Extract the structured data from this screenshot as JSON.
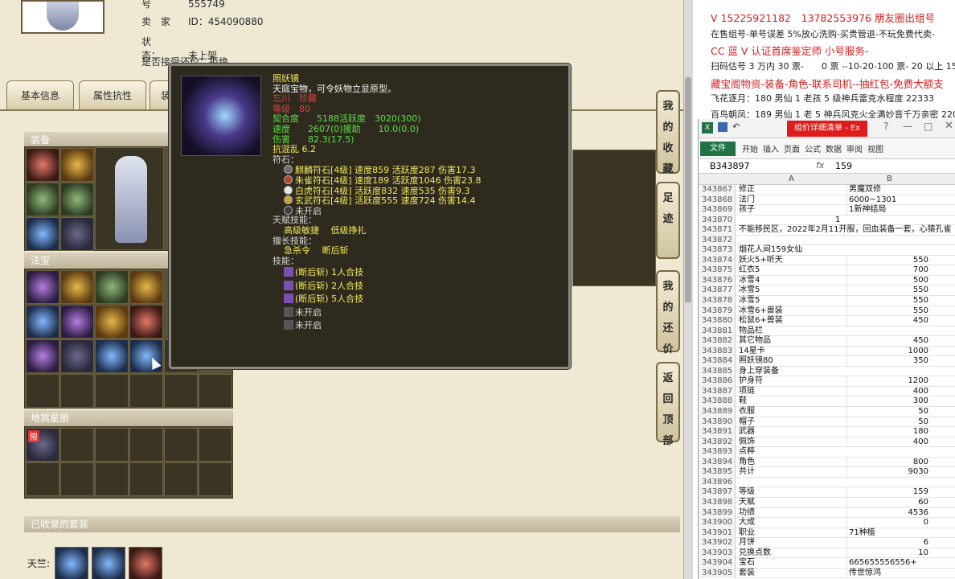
{
  "profile": {
    "number_label": "号",
    "number_value": "555749",
    "seller_label": "卖　家",
    "seller_value": "ID：454090880",
    "status_label": "状　　态：",
    "status_value": "未上架",
    "accept_label": "是否接受还价：",
    "accept_value": "拒绝"
  },
  "tabs": [
    "基本信息",
    "属性抗性",
    "装"
  ],
  "sections": {
    "equipment": "装备",
    "fabao": "法宝",
    "dishastars": "地煞星册",
    "suits": "已收录的套装",
    "tianzhu_label": "天竺:"
  },
  "badge_limited": "限",
  "side_buttons": [
    "我的收藏",
    "足迹",
    "我的还价",
    "返回顶部"
  ],
  "tooltip": {
    "name": "照妖镜",
    "desc": "天庭宝物，可令妖物立显原型。",
    "school": "忘川　珍藏",
    "level": "等级　80",
    "fit": "契合度　　5188活跃度　3020(300)",
    "speed": "速度　　2607(0)援助　　10.0(0.0)",
    "damage": "伤害　　82.3(17.5)",
    "resist": "抗混乱 6.2",
    "runes_label": "符石：",
    "runes": [
      "麒麟符石[4级] 速度859 活跃度287 伤害17.3",
      "朱雀符石[4级] 速度189 活跃度1046 伤害23.8",
      "白虎符石[4级] 活跃度832 速度535 伤害9.3",
      "玄武符石[4级] 活跃度555 速度724 伤害14.4",
      "未开启"
    ],
    "talent_label": "天赋技能：",
    "talent": "高级敏捷　 低级挣扎",
    "good_at_label": "擅长技能：",
    "good_at": "急杀令　 断后斩",
    "skills_label": "技能：",
    "skills": [
      "(断后斩) 1人合技",
      "(断后斩) 2人合技",
      "(断后斩) 5人合技",
      "未开启",
      "未开启"
    ]
  },
  "right_top": [
    "V 15225921182　13782553976 朋友圈出组号",
    "在售组号-单号误差 5%放心洗购-买贵管退-不玩免费代卖-",
    "CC 蓝 V 认证首席鉴定师 小号服务-",
    "扫码估号 3 万内 30 票-　　0 票 --10-20-100 票- 20 以上 150",
    "藏宝阁物资-装备-角色-联系司机--抽红包-免费大额支",
    "飞花逐月：180 男仙 1 老孩 5 级神兵雷克水程度 22333",
    "百鸟朝凤：189 男仙 1 老 5 神兵风克火全满妙音千万亲密 2200"
  ],
  "excel": {
    "title_tab": "组价详细清单 - Ex",
    "ribbon_file": "文件",
    "ribbon_tabs": [
      "开始",
      "插入",
      "页面",
      "公式",
      "数据",
      "审阅",
      "视图"
    ],
    "cell_ref": "B343897",
    "fx": "fx",
    "formula": "159",
    "col_a": "A",
    "col_b": "B",
    "rows": [
      {
        "n": "343867",
        "a": "修正",
        "b": "男魔双修",
        "al": "l"
      },
      {
        "n": "343868",
        "a": "法门",
        "b": "6000~1301",
        "al": "l"
      },
      {
        "n": "343869",
        "a": "孩子",
        "b": "1新神结局",
        "al": "l"
      },
      {
        "n": "343870",
        "a": "",
        "b": "",
        "al": "r",
        "mid": "1"
      },
      {
        "n": "343871",
        "a": "不能移民区，2022年2月11开服，回血装备一套，心猿孔雀",
        "b": "",
        "al": "r"
      },
      {
        "n": "343872",
        "a": "",
        "b": "",
        "al": "r"
      },
      {
        "n": "343873",
        "a": "烟花人间159女仙",
        "b": "",
        "al": "r"
      },
      {
        "n": "343874",
        "a": "妖火5+听天",
        "b": "550",
        "al": "r"
      },
      {
        "n": "343875",
        "a": "红衣5",
        "b": "700",
        "al": "r"
      },
      {
        "n": "343876",
        "a": "冰雪4",
        "b": "500",
        "al": "r"
      },
      {
        "n": "343877",
        "a": "冰雪5",
        "b": "550",
        "al": "r"
      },
      {
        "n": "343878",
        "a": "冰雪5",
        "b": "550",
        "al": "r"
      },
      {
        "n": "343879",
        "a": "冰雪6+兽装",
        "b": "550",
        "al": "r"
      },
      {
        "n": "343880",
        "a": "松鼠6+兽装",
        "b": "450",
        "al": "r"
      },
      {
        "n": "343881",
        "a": "物品栏",
        "b": "",
        "al": "r"
      },
      {
        "n": "343882",
        "a": "其它物品",
        "b": "450",
        "al": "r"
      },
      {
        "n": "343883",
        "a": "14星卡",
        "b": "1000",
        "al": "r"
      },
      {
        "n": "343884",
        "a": "照妖镜80",
        "b": "350",
        "al": "r"
      },
      {
        "n": "343885",
        "a": "身上穿装备",
        "b": "",
        "al": "r"
      },
      {
        "n": "343886",
        "a": "护身符",
        "b": "1200",
        "al": "r"
      },
      {
        "n": "343887",
        "a": "项链",
        "b": "400",
        "al": "r"
      },
      {
        "n": "343888",
        "a": "鞋",
        "b": "300",
        "al": "r"
      },
      {
        "n": "343889",
        "a": "衣服",
        "b": "50",
        "al": "r"
      },
      {
        "n": "343890",
        "a": "帽子",
        "b": "50",
        "al": "r"
      },
      {
        "n": "343891",
        "a": "武器",
        "b": "180",
        "al": "r"
      },
      {
        "n": "343892",
        "a": "佩饰",
        "b": "400",
        "al": "r"
      },
      {
        "n": "343893",
        "a": "点粹",
        "b": "",
        "al": "r"
      },
      {
        "n": "343894",
        "a": "角色",
        "b": "800",
        "al": "r"
      },
      {
        "n": "343895",
        "a": "共计",
        "b": "9030",
        "al": "r"
      },
      {
        "n": "343896",
        "a": "",
        "b": "",
        "al": "r"
      },
      {
        "n": "343897",
        "a": "等级",
        "b": "159",
        "al": "r"
      },
      {
        "n": "343898",
        "a": "天赋",
        "b": "60",
        "al": "r"
      },
      {
        "n": "343899",
        "a": "功绩",
        "b": "4536",
        "al": "r"
      },
      {
        "n": "343900",
        "a": "大成",
        "b": "0",
        "al": "r"
      },
      {
        "n": "343901",
        "a": "职业",
        "b": "71种植",
        "al": "l"
      },
      {
        "n": "343902",
        "a": "月饼",
        "b": "6",
        "al": "r"
      },
      {
        "n": "343903",
        "a": "兑换点数",
        "b": "10",
        "al": "r"
      },
      {
        "n": "343904",
        "a": "宝石",
        "b": "665655556556+",
        "al": "l"
      },
      {
        "n": "343905",
        "a": "套装",
        "b": "传世惊鸿",
        "al": "l"
      }
    ]
  }
}
